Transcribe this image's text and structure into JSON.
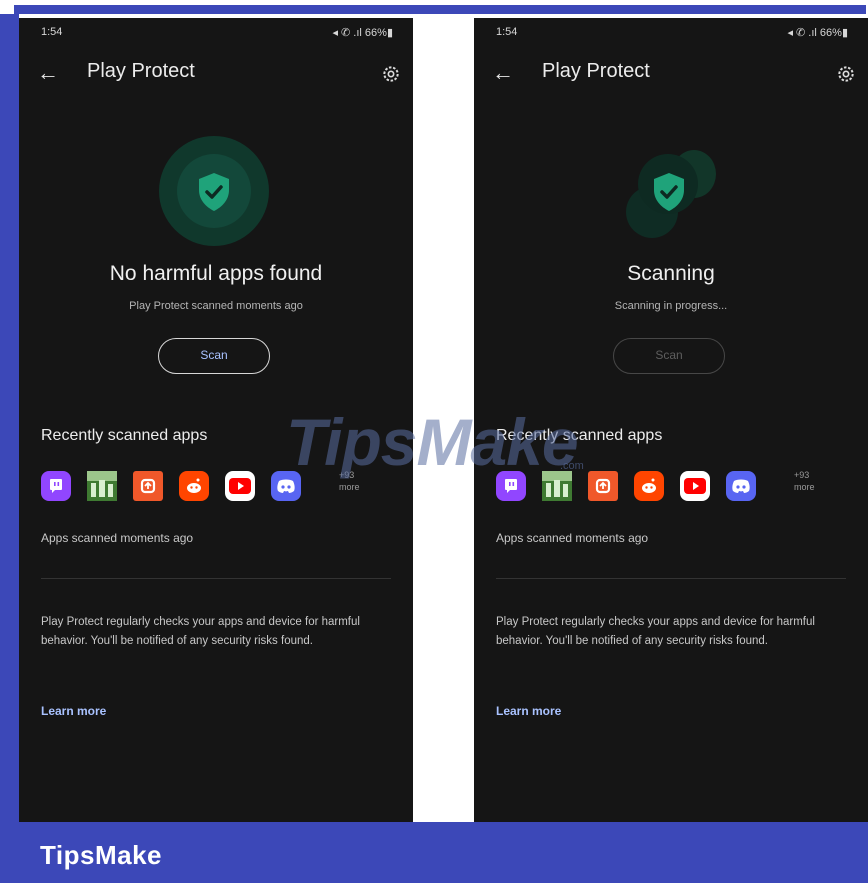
{
  "brand": "TipsMake",
  "watermark": {
    "text": "TipsMake",
    "suffix": ".com"
  },
  "status_bar": {
    "time": "1:54",
    "battery": "66%"
  },
  "screens": [
    {
      "title": "Play Protect",
      "headline": "No harmful apps found",
      "subtitle": "Play Protect scanned moments ago",
      "scan_button": "Scan",
      "scan_enabled": true,
      "section_title": "Recently scanned apps",
      "more": {
        "count": "+93",
        "label": "more"
      },
      "scanned_text": "Apps scanned moments ago",
      "description": "Play Protect regularly checks your apps and device for harmful behavior. You'll be notified of any security risks found.",
      "learn_more": "Learn more"
    },
    {
      "title": "Play Protect",
      "headline": "Scanning",
      "subtitle": "Scanning in progress...",
      "scan_button": "Scan",
      "scan_enabled": false,
      "section_title": "Recently scanned apps",
      "more": {
        "count": "+93",
        "label": "more"
      },
      "scanned_text": "Apps scanned moments ago",
      "description": "Play Protect regularly checks your apps and device for harmful behavior. You'll be notified of any security risks found.",
      "learn_more": "Learn more"
    }
  ],
  "app_icons": [
    {
      "name": "twitch-icon",
      "color": "#9146ff"
    },
    {
      "name": "game-icon",
      "color": "#4c8a3a"
    },
    {
      "name": "orange-app-icon",
      "color": "#f0582a"
    },
    {
      "name": "reddit-icon",
      "color": "#ff4500"
    },
    {
      "name": "youtube-icon",
      "color": "#ffffff"
    },
    {
      "name": "discord-icon",
      "color": "#5865f2"
    }
  ],
  "colors": {
    "accent": "#a9c2ff",
    "shield": "#1fa37a",
    "frame": "#3c48b8"
  }
}
